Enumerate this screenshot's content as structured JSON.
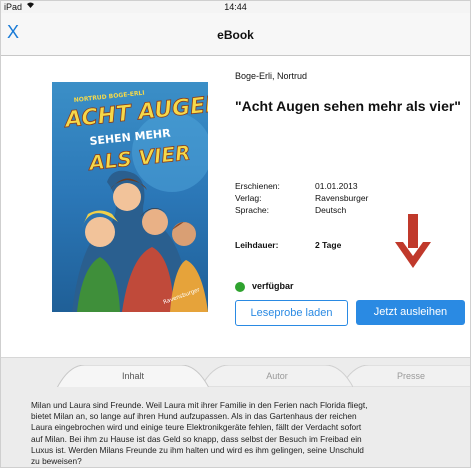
{
  "statusbar": {
    "device": "iPad",
    "time": "14:44"
  },
  "navbar": {
    "close_label": "X",
    "title": "eBook"
  },
  "cover": {
    "author_text": "NORTRUD BOGE-ERLI",
    "title_line1": "ACHT AUGEN",
    "title_line2": "SEHEN MEHR",
    "title_line3": "ALS VIER",
    "publisher": "Ravensburger"
  },
  "book": {
    "author": "Boge-Erli, Nortrud",
    "title": "\"Acht Augen sehen mehr als vier\"",
    "meta": [
      {
        "key": "Erschienen:",
        "value": "01.01.2013"
      },
      {
        "key": "Verlag:",
        "value": "Ravensburger"
      },
      {
        "key": "Sprache:",
        "value": "Deutsch"
      }
    ],
    "loan_label": "Leihdauer:",
    "loan_value": "2 Tage",
    "availability": "verfügbar"
  },
  "actions": {
    "preview_label": "Leseprobe laden",
    "borrow_label": "Jetzt ausleihen"
  },
  "tabs": [
    {
      "label": "Inhalt"
    },
    {
      "label": "Autor"
    },
    {
      "label": "Presse"
    }
  ],
  "description_lines": [
    "Milan und Laura sind Freunde. Weil Laura mit ihrer Familie in den Ferien nach Florida fliegt,",
    "bietet Milan an, so lange auf ihren Hund aufzupassen. Als in das Gartenhaus der reichen",
    "Laura eingebrochen wird und einige teure Elektronikgeräte fehlen, fällt der Verdacht sofort",
    "auf Milan. Bei ihm zu Hause ist das Geld so knapp, dass selbst der Besuch im Freibad ein",
    "Luxus ist. Werden Milans Freunde zu ihm halten und wird es ihm gelingen, seine Unschuld",
    "zu beweisen?"
  ],
  "colors": {
    "accent": "#2a8ae3",
    "available": "#2fa32f",
    "arrow": "#c0392b"
  },
  "icons": {
    "close": "close-icon",
    "wifi": "wifi-icon",
    "available": "status-dot-icon",
    "arrow": "down-arrow-icon"
  }
}
